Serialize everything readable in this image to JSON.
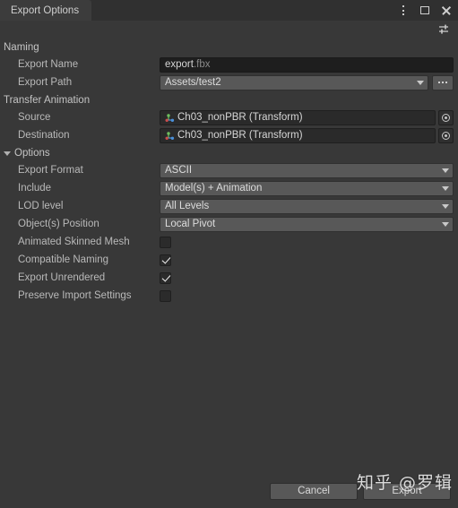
{
  "titlebar": {
    "tab_label": "Export Options",
    "menu_icon": "kebab-menu-icon",
    "maximize_icon": "maximize-icon",
    "close_icon": "close-icon",
    "settings_icon": "sliders-settings-icon"
  },
  "sections": {
    "naming": {
      "header": "Naming",
      "export_name": {
        "label": "Export Name",
        "value_base": "export",
        "value_ext": ".fbx"
      },
      "export_path": {
        "label": "Export Path",
        "value": "Assets/test2",
        "browse_label": "...",
        "dropdown_icon": "chevron-down-icon"
      }
    },
    "transfer_animation": {
      "header": "Transfer Animation",
      "source": {
        "label": "Source",
        "value": "Ch03_nonPBR (Transform)",
        "object_icon": "transform-gizmo-icon",
        "picker_icon": "object-picker-icon"
      },
      "destination": {
        "label": "Destination",
        "value": "Ch03_nonPBR (Transform)",
        "object_icon": "transform-gizmo-icon",
        "picker_icon": "object-picker-icon"
      }
    },
    "options": {
      "header": "Options",
      "foldout_icon": "foldout-expanded-icon",
      "dropdowns": [
        {
          "label": "Export Format",
          "value": "ASCII"
        },
        {
          "label": "Include",
          "value": "Model(s) + Animation"
        },
        {
          "label": "LOD level",
          "value": "All Levels"
        },
        {
          "label": "Object(s) Position",
          "value": "Local Pivot"
        }
      ],
      "checkboxes": [
        {
          "label": "Animated Skinned Mesh",
          "checked": false
        },
        {
          "label": "Compatible Naming",
          "checked": true
        },
        {
          "label": "Export Unrendered",
          "checked": true
        },
        {
          "label": "Preserve Import Settings",
          "checked": false
        }
      ]
    }
  },
  "footer": {
    "cancel_label": "Cancel",
    "export_label": "Export"
  },
  "watermark": {
    "text": "知乎 @罗辑"
  },
  "colors": {
    "window_bg": "#383838",
    "titlebar_bg": "#303030",
    "tab_bg": "#3c3c3c",
    "input_bg": "#1e1e1e",
    "dropdown_bg": "#585858",
    "object_field_bg": "#2a2a2a",
    "text": "#c4c4c4"
  }
}
